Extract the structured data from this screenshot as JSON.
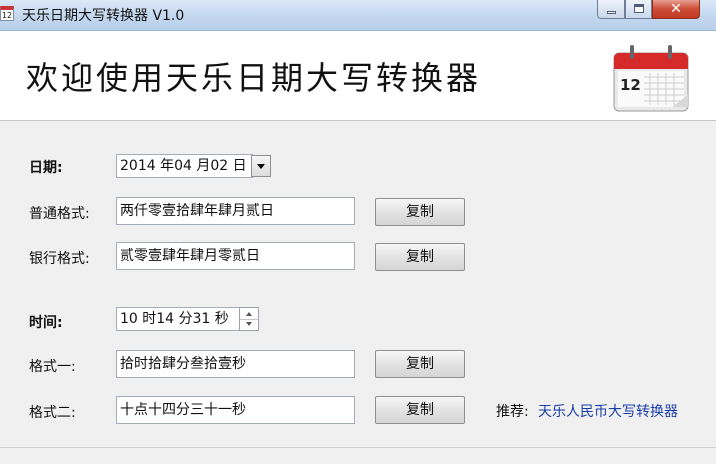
{
  "window": {
    "title": "天乐日期大写转换器 V1.0",
    "app_icon_text": "12",
    "close_glyph": "✕"
  },
  "banner": {
    "title": "欢迎使用天乐日期大写转换器",
    "calendar_icon_day": "12"
  },
  "date_section": {
    "label": "日期:",
    "picker_value": "2014 年04 月02 日",
    "normal_format_label": "普通格式:",
    "normal_format_value": "两仟零壹拾肆年肆月贰日",
    "bank_format_label": "银行格式:",
    "bank_format_value": "贰零壹肆年肆月零贰日",
    "copy_label": "复制"
  },
  "time_section": {
    "label": "时间:",
    "picker_value": "10 时14 分31 秒",
    "format1_label": "格式一:",
    "format1_value": "拾时拾肆分叁拾壹秒",
    "format2_label": "格式二:",
    "format2_value": "十点十四分三十一秒",
    "copy_label": "复制"
  },
  "recommend": {
    "label": "推荐:",
    "link_text": "天乐人民币大写转换器",
    "link_color": "#1a3ea8"
  }
}
